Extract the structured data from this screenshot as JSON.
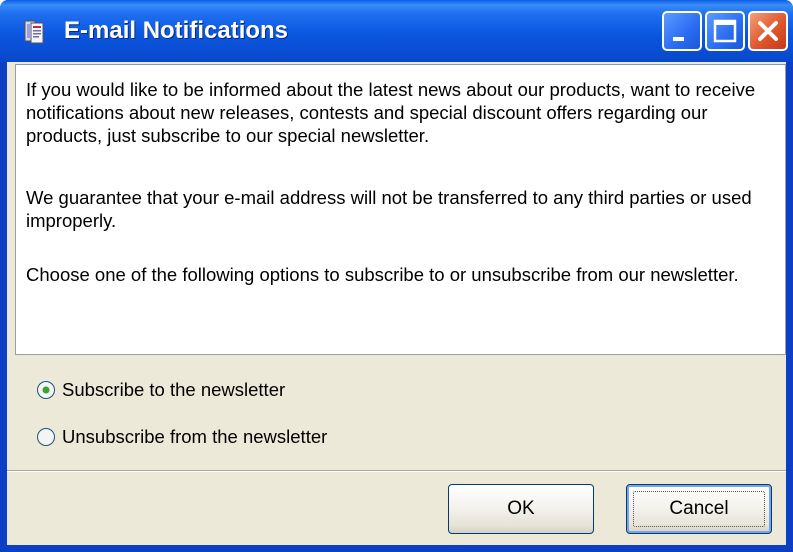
{
  "window": {
    "title": "E-mail Notifications",
    "icon": "newsletter-app-icon",
    "controls": {
      "minimize": "minimize-icon",
      "maximize": "maximize-icon",
      "close": "close-icon"
    },
    "colors": {
      "titlebar": "#0a4fd6",
      "client": "#ece9d8",
      "close": "#e0562e"
    }
  },
  "message": {
    "p1": "If you would like to be informed about the latest news about our products, want to receive notifications about new releases, contests and special discount offers regarding our products, just subscribe to our special newsletter.",
    "p2": "We guarantee that your e-mail address will not be transferred to any third parties or used improperly.",
    "p3": "Choose one of the following options to subscribe to or unsubscribe from our newsletter."
  },
  "options": [
    {
      "label": "Subscribe to the newsletter",
      "selected": true
    },
    {
      "label": "Unsubscribe from the newsletter",
      "selected": false
    }
  ],
  "buttons": {
    "ok": "OK",
    "cancel": "Cancel"
  }
}
